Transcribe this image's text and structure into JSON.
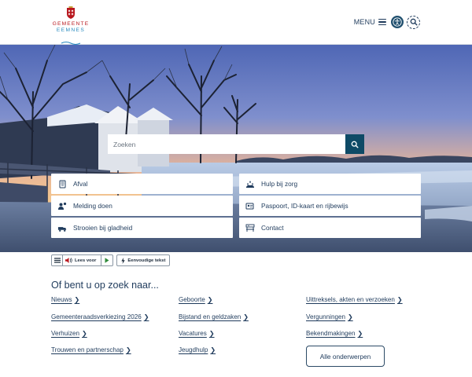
{
  "header": {
    "logo_line1": "GEMEENTE",
    "logo_line2": "EEMNES",
    "menu_label": "MENU",
    "accessibility_icon": "accessibility-icon",
    "search_icon": "search-icon"
  },
  "hero": {
    "search_placeholder": "Zoeken",
    "tiles": [
      {
        "label": "Afval",
        "icon": "waste-bin-icon"
      },
      {
        "label": "Hulp bij zorg",
        "icon": "care-hands-icon"
      },
      {
        "label": "Melding doen",
        "icon": "report-person-icon"
      },
      {
        "label": "Paspoort, ID-kaart en rijbewijs",
        "icon": "id-card-icon"
      },
      {
        "label": "Strooien bij gladheid",
        "icon": "salt-truck-icon"
      },
      {
        "label": "Contact",
        "icon": "contact-desk-icon"
      }
    ]
  },
  "readbar": {
    "listen_label": "Lees voor",
    "easy_text_label": "Eenvoudige tekst"
  },
  "lower": {
    "title": "Of bent u op zoek naar...",
    "links": [
      "Nieuws",
      "Geboorte",
      "Uittreksels, akten en verzoeken",
      "Gemeenteraadsverkiezing 2026",
      "Bijstand en geldzaken",
      "Vergunningen",
      "Verhuizen",
      "Vacatures",
      "Bekendmakingen",
      "Trouwen en partnerschap",
      "Jeugdhulp"
    ],
    "all_topics_label": "Alle onderwerpen"
  },
  "colors": {
    "primary": "#0e4a66",
    "text": "#1f3b5c",
    "logo_red": "#b8171e",
    "logo_blue": "#2a8bbf"
  }
}
